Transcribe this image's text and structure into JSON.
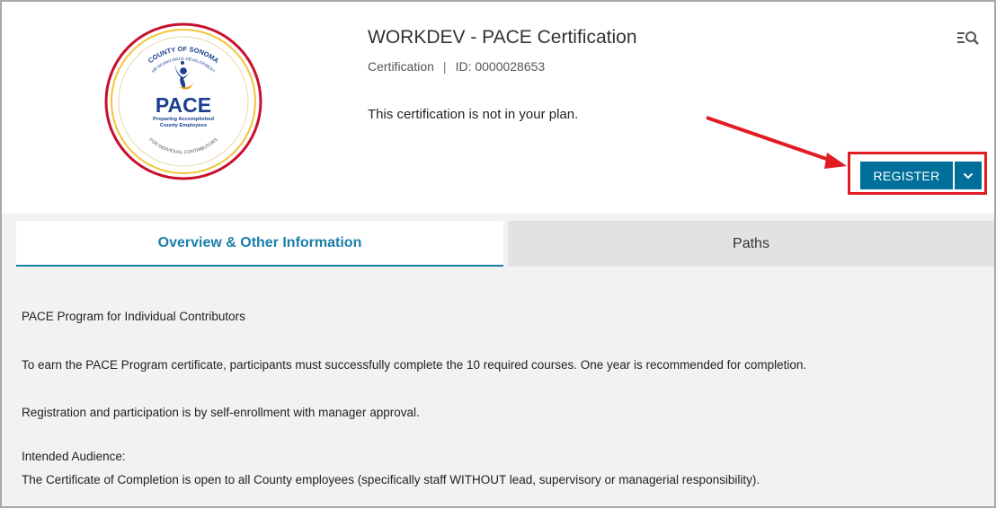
{
  "header": {
    "title": "WORKDEV - PACE Certification",
    "type_label": "Certification",
    "separator": "|",
    "id_label": "ID: 0000028653",
    "plan_status": "This certification is not in your plan.",
    "icon": "search-list-icon"
  },
  "logo": {
    "top_arc_text": "COUNTY OF SONOMA",
    "sub_arc_text": "HR WORKFORCE DEVELOPMENT",
    "name": "PACE",
    "tagline_1": "Preparing Accomplished",
    "tagline_2": "County Employees",
    "bottom_arc_text": "FOR INDIVIDUAL CONTRIBUTORS",
    "colors": {
      "outer_ring": "#c8102e",
      "inner_ring": "#f0c63a",
      "brand": "#1b3f8f"
    }
  },
  "actions": {
    "register_label": "REGISTER",
    "dropdown_icon": "chevron-down-icon",
    "button_color": "#006f9a",
    "annotation_color": "#e31b23"
  },
  "tabs": [
    {
      "label": "Overview & Other Information",
      "active": true
    },
    {
      "label": "Paths",
      "active": false
    }
  ],
  "description": {
    "line1": "PACE Program for Individual Contributors",
    "line2": "To earn the PACE Program certificate, participants must successfully complete the 10 required courses. One year is recommended for completion.",
    "line3": "Registration and participation is by self-enrollment with manager approval.",
    "line4": "Intended Audience:",
    "line5": "The Certificate of Completion is open to all County employees (specifically staff WITHOUT lead, supervisory or managerial responsibility)."
  }
}
